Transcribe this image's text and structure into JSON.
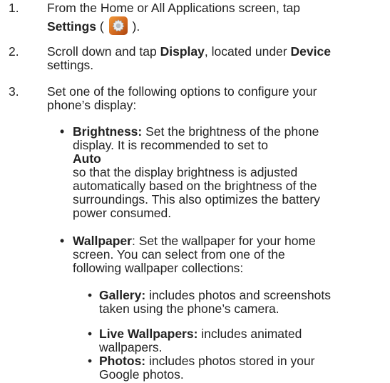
{
  "steps": [
    {
      "number": "1.",
      "line1": "From the Home or All Applications screen, tap",
      "bold1": "Settings",
      "open": "(",
      "close": ").",
      "icon": "settings-gear-icon"
    },
    {
      "number": "2.",
      "pre": "Scroll down and tap",
      "bold1": "Display",
      "mid": ", located under",
      "bold2": "Device",
      "line2": "settings."
    },
    {
      "number": "3.",
      "line1": "Set one of the following options to configure your",
      "line2": "phone’s display:"
    }
  ],
  "bullets": [
    {
      "marker": "•",
      "label": "Brightness:",
      "lines": [
        "Set the brightness of the phone",
        "display. It is recommended to set to",
        "so that the display brightness is adjusted",
        "automatically based on the brightness of the",
        "surroundings. This also optimizes the battery",
        "power consumed."
      ],
      "bold_word": "Auto"
    },
    {
      "marker": "•",
      "label": "Wallpaper",
      "lines": [
        ": Set the wallpaper for your home",
        "screen. You can select from one of the",
        "following wallpaper collections:"
      ]
    }
  ],
  "collections": [
    {
      "marker": "•",
      "label": "Gallery:",
      "line1": "includes photos and screenshots",
      "line2": "taken using the phone’s camera."
    },
    {
      "marker": "•",
      "label": "Live Wallpapers:",
      "line1": "includes animated",
      "line2": "wallpapers."
    },
    {
      "marker": "•",
      "label": "Photos:",
      "line1": "includes photos stored in your",
      "line2": "Google photos."
    }
  ]
}
